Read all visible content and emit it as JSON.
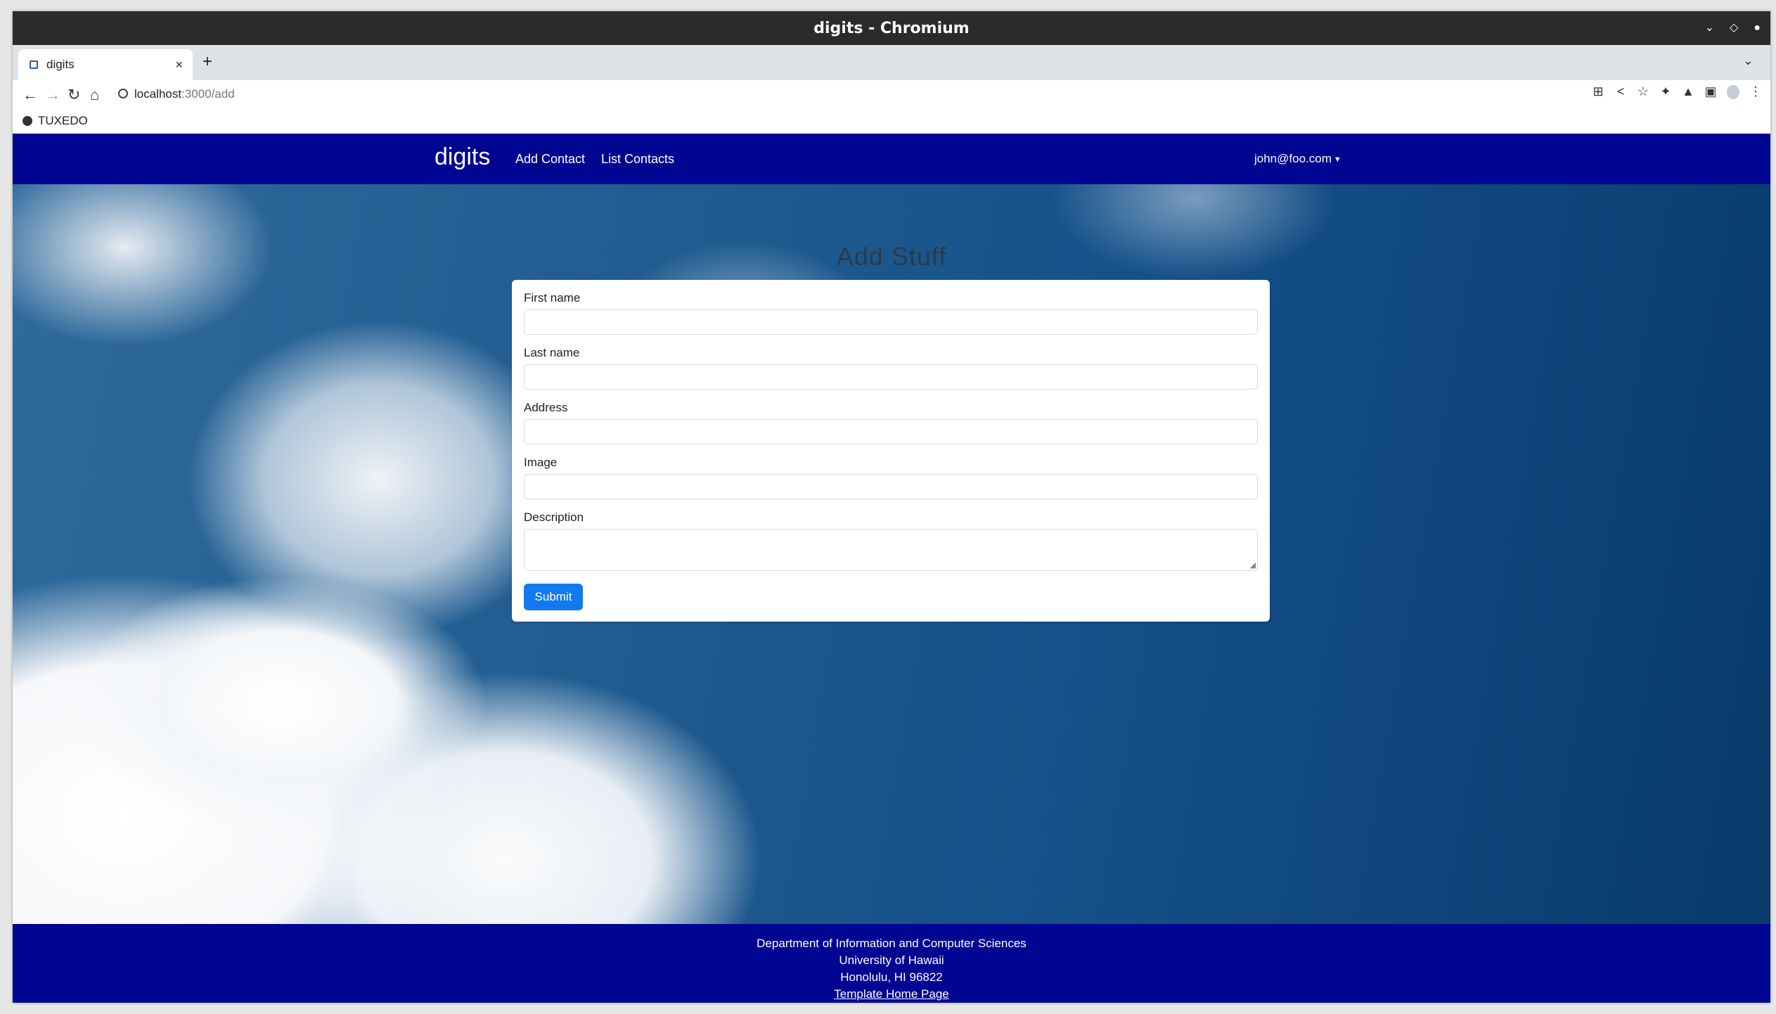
{
  "browser": {
    "window_title": "digits - Chromium",
    "tab_title": "digits",
    "url_host": "localhost",
    "url_path": ":3000/add",
    "bookmark": "TUXEDO"
  },
  "navbar": {
    "brand": "digits",
    "links": [
      "Add Contact",
      "List Contacts"
    ],
    "user": "john@foo.com"
  },
  "page": {
    "title": "Add Stuff"
  },
  "form": {
    "fields": [
      {
        "label": "First name",
        "value": ""
      },
      {
        "label": "Last name",
        "value": ""
      },
      {
        "label": "Address",
        "value": ""
      },
      {
        "label": "Image",
        "value": ""
      },
      {
        "label": "Description",
        "value": ""
      }
    ],
    "submit_label": "Submit"
  },
  "footer": {
    "lines": [
      "Department of Information and Computer Sciences",
      "University of Hawaii",
      "Honolulu, HI 96822"
    ],
    "link": "Template Home Page"
  },
  "colors": {
    "navbar": "#000592",
    "submit": "#1479f0"
  }
}
